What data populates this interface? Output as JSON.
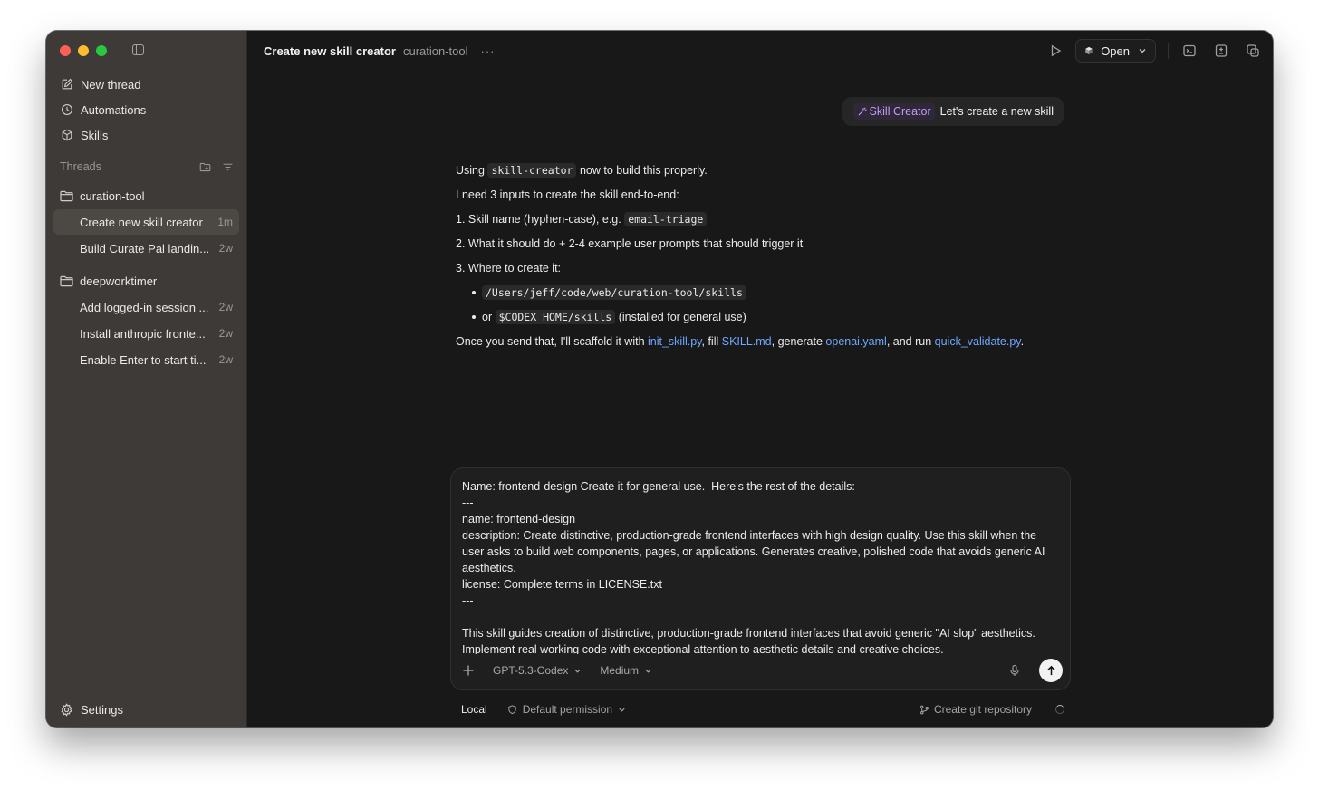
{
  "sidebar": {
    "nav": [
      {
        "label": "New thread",
        "icon": "edit-icon"
      },
      {
        "label": "Automations",
        "icon": "clock-icon"
      },
      {
        "label": "Skills",
        "icon": "cube-icon"
      }
    ],
    "threads_heading": "Threads",
    "folders": [
      {
        "name": "curation-tool",
        "threads": [
          {
            "title": "Create new skill creator",
            "age": "1m",
            "active": true
          },
          {
            "title": "Build Curate Pal landin...",
            "age": "2w"
          }
        ]
      },
      {
        "name": "deepworktimer",
        "threads": [
          {
            "title": "Add logged-in session ...",
            "age": "2w"
          },
          {
            "title": "Install anthropic fronte...",
            "age": "2w"
          },
          {
            "title": "Enable Enter to start ti...",
            "age": "2w"
          }
        ]
      }
    ],
    "settings_label": "Settings"
  },
  "header": {
    "title": "Create new skill creator",
    "project": "curation-tool",
    "more": "···",
    "open_label": "Open"
  },
  "user_message": {
    "skill_chip": "Skill Creator",
    "text": "Let's create a new skill"
  },
  "assistant": {
    "p1_pre": "Using",
    "p1_code": "skill-creator",
    "p1_post": "now to build this properly.",
    "p2": "I need 3 inputs to create the skill end-to-end:",
    "item1_pre": "1. Skill name (hyphen-case), e.g.",
    "item1_code": "email-triage",
    "item2": "2. What it should do + 2-4 example user prompts that should trigger it",
    "item3": "3. Where to create it:",
    "bullet1_code": "/Users/jeff/code/web/curation-tool/skills",
    "bullet2_pre": "or",
    "bullet2_code": "$CODEX_HOME/skills",
    "bullet2_post": "(installed for general use)",
    "closing_1": "Once you send that, I'll scaffold it with",
    "link1": "init_skill.py",
    "closing_2": ", fill",
    "link2": "SKILL.md",
    "closing_3": ", generate",
    "link3": "openai.yaml",
    "closing_4": ", and run",
    "link4": "quick_validate.py",
    "closing_5": "."
  },
  "composer": {
    "text": "Name: frontend-design Create it for general use.  Here's the rest of the details:\n---\nname: frontend-design\ndescription: Create distinctive, production-grade frontend interfaces with high design quality. Use this skill when the user asks to build web components, pages, or applications. Generates creative, polished code that avoids generic AI aesthetics.\nlicense: Complete terms in LICENSE.txt\n---\n\nThis skill guides creation of distinctive, production-grade frontend interfaces that avoid generic \"AI slop\" aesthetics. Implement real working code with exceptional attention to aesthetic details and creative choices.",
    "model": "GPT-5.3-Codex",
    "effort": "Medium"
  },
  "footer": {
    "local": "Local",
    "permission": "Default permission",
    "git": "Create git repository"
  },
  "colors": {
    "sidebar_bg": "#3d3a37",
    "main_bg": "#181818",
    "link": "#6ea8ff",
    "skill_chip": "#c39cf7"
  }
}
